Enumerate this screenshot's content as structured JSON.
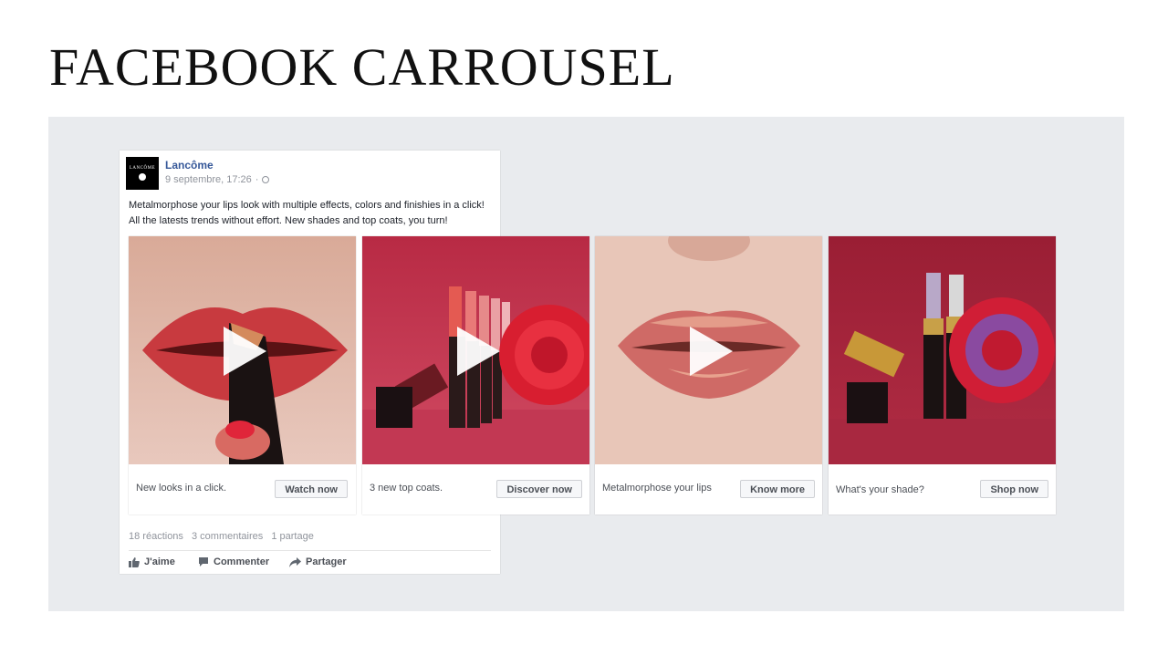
{
  "slide": {
    "title": "FACEBOOK CARROUSEL"
  },
  "post": {
    "page_name": "Lancôme",
    "avatar_text": "LANCÔME",
    "timestamp": "9 septembre, 17:26",
    "separator": "·",
    "text_lines": [
      "Metalmorphose your lips look with multiple effects, colors and finishies in a click!",
      "All the latests trends without effort. New shades and top coats, you turn!"
    ],
    "privacy_icon": "globe-icon",
    "accent_color": "#365899"
  },
  "carousel": [
    {
      "caption": "New looks in a click.",
      "button": "Watch now",
      "media": "video",
      "image": "lips-applying-lipstick"
    },
    {
      "caption": "3 new top coats.",
      "button": "Discover now",
      "media": "video",
      "image": "lipsticks-with-rose"
    },
    {
      "caption": "Metalmorphose your lips",
      "button": "Know more",
      "media": "video",
      "image": "metallic-lips"
    },
    {
      "caption": "What's your shade?",
      "button": "Shop now",
      "media": "image",
      "image": "lipsticks-with-rose-close"
    }
  ],
  "stats": {
    "reactions": "18 réactions",
    "comments": "3 commentaires",
    "shares": "1 partage"
  },
  "actions": {
    "like": "J'aime",
    "comment": "Commenter",
    "share": "Partager"
  }
}
